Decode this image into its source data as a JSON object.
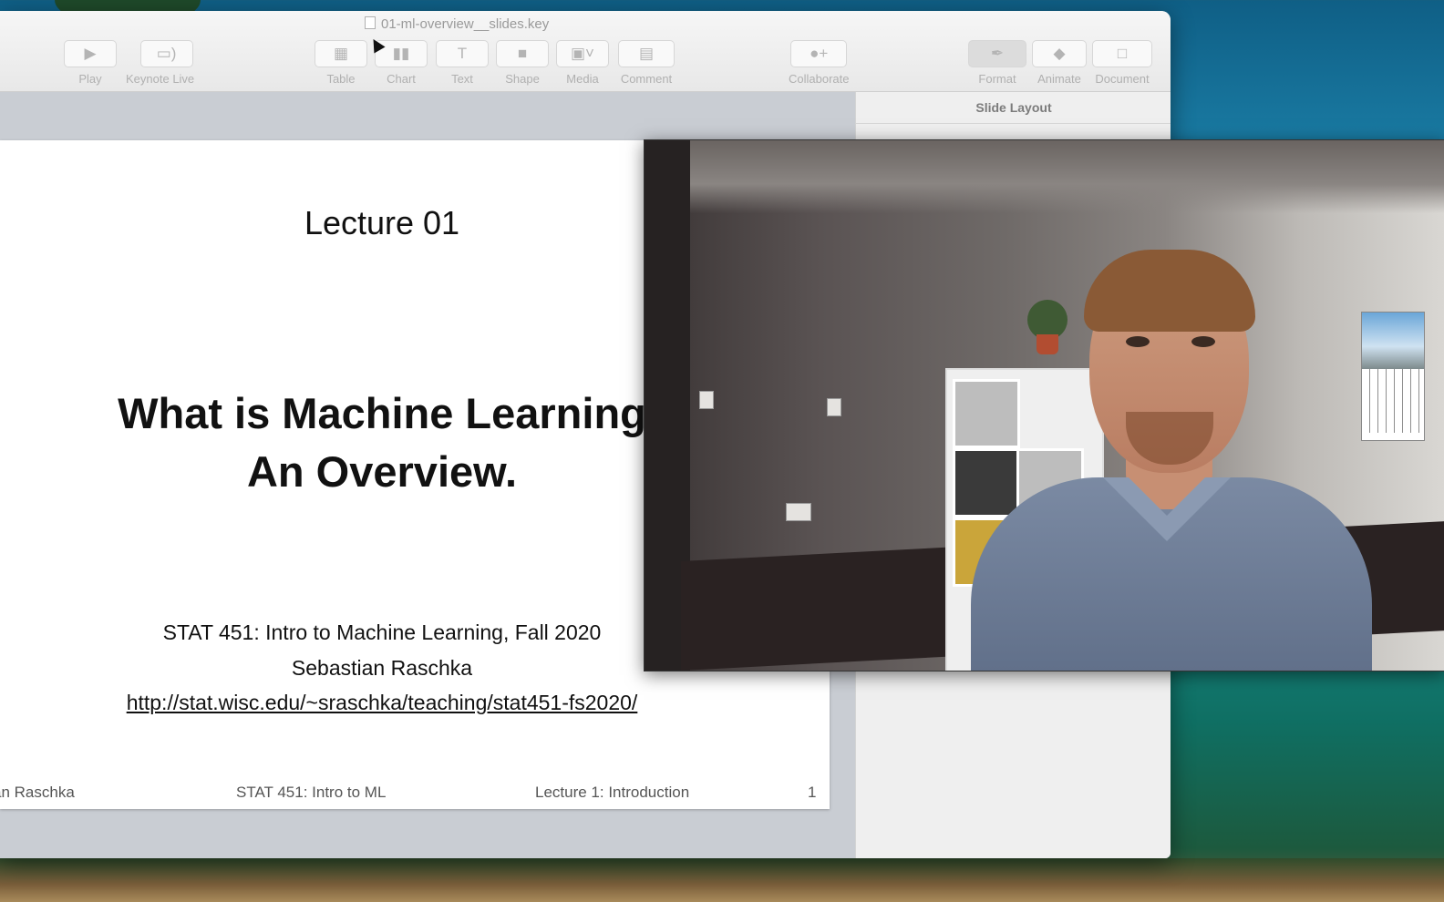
{
  "window": {
    "title": "01-ml-overview__slides.key"
  },
  "toolbar": {
    "buttons": [
      {
        "label": "Play",
        "icon": "play-icon"
      },
      {
        "label": "Keynote Live",
        "icon": "keynote-live-icon"
      },
      {
        "label": "Table",
        "icon": "table-icon"
      },
      {
        "label": "Chart",
        "icon": "chart-icon"
      },
      {
        "label": "Text",
        "icon": "text-icon"
      },
      {
        "label": "Shape",
        "icon": "shape-icon"
      },
      {
        "label": "Media",
        "icon": "media-icon"
      },
      {
        "label": "Comment",
        "icon": "comment-icon"
      },
      {
        "label": "Collaborate",
        "icon": "collaborate-icon"
      },
      {
        "label": "Format",
        "icon": "format-brush-icon"
      },
      {
        "label": "Animate",
        "icon": "animate-icon"
      },
      {
        "label": "Document",
        "icon": "document-icon"
      }
    ]
  },
  "inspector": {
    "header": "Slide Layout"
  },
  "slide": {
    "lecture": "Lecture 01",
    "title_line1": "What is Machine Learning",
    "title_line2": "An Overview.",
    "course": "STAT 451: Intro to Machine Learning, Fall 2020",
    "author": "Sebastian Raschka",
    "url": "http://stat.wisc.edu/~sraschka/teaching/stat451-fs2020/",
    "footer": {
      "author": "an Raschka",
      "course": "STAT 451: Intro to ML",
      "lecture": "Lecture 1: Introduction",
      "page": "1"
    }
  },
  "colors": {
    "toolbar_bg": "#f0f0f0",
    "canvas_bg": "#c9cdd3",
    "slide_bg": "#ffffff",
    "inspector_bg": "#efefef",
    "desktop_water": "#1f7f9e"
  }
}
